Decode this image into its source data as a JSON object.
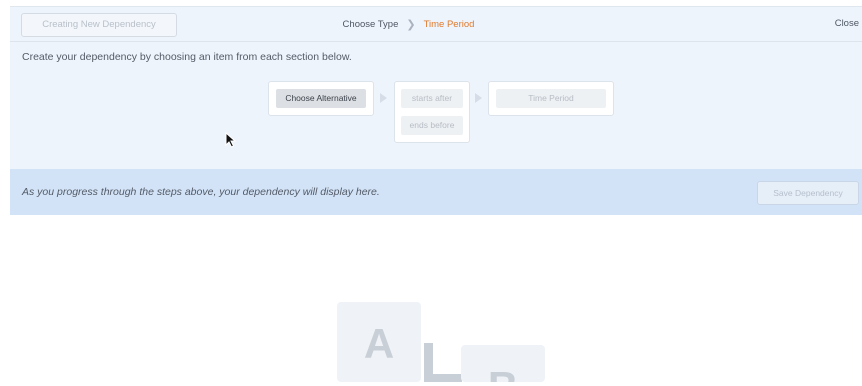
{
  "header": {
    "new_dependency_button": "Creating New Dependency",
    "breadcrumb": [
      "Choose Type",
      "Time Period"
    ],
    "close_label": "Close"
  },
  "instructions": "Create your dependency by choosing an item from each section below.",
  "steps": {
    "alternative": "Choose Alternative",
    "relations": [
      "starts after",
      "ends before"
    ],
    "time_period": "Time Period"
  },
  "result": {
    "placeholder": "As you progress through the steps above, your dependency will display here.",
    "save_button": "Save Dependency"
  },
  "illustration": {
    "box_a": "A",
    "box_b": "B"
  },
  "colors": {
    "panel_bg": "#eef4fc",
    "result_bar_bg": "#d3e3f7",
    "active_crumb": "#e07a2c"
  }
}
